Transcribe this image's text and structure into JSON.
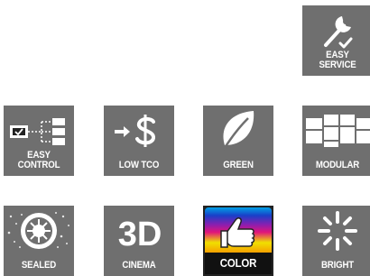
{
  "tiles": {
    "easy_service": {
      "label": "EASY\nSERVICE",
      "icon": "wrench-check-icon"
    },
    "easy_control": {
      "label": "EASY\nCONTROL",
      "icon": "control-network-icon"
    },
    "low_tco": {
      "label": "LOW TCO",
      "icon": "arrow-dollar-icon"
    },
    "green": {
      "label": "GREEN",
      "icon": "leaf-icon"
    },
    "modular": {
      "label": "MODULAR",
      "icon": "modular-blocks-icon"
    },
    "sealed": {
      "label": "SEALED",
      "icon": "sealed-burst-icon"
    },
    "cinema": {
      "label": "CINEMA",
      "icon": "3d-icon",
      "icon_text": "3D"
    },
    "color": {
      "label": "COLOR",
      "icon": "thumbs-up-icon"
    },
    "bright": {
      "label": "BRIGHT",
      "icon": "bright-burst-icon"
    }
  },
  "colors": {
    "tile_background": "#6f6f6f",
    "label_text": "#ffffff"
  }
}
